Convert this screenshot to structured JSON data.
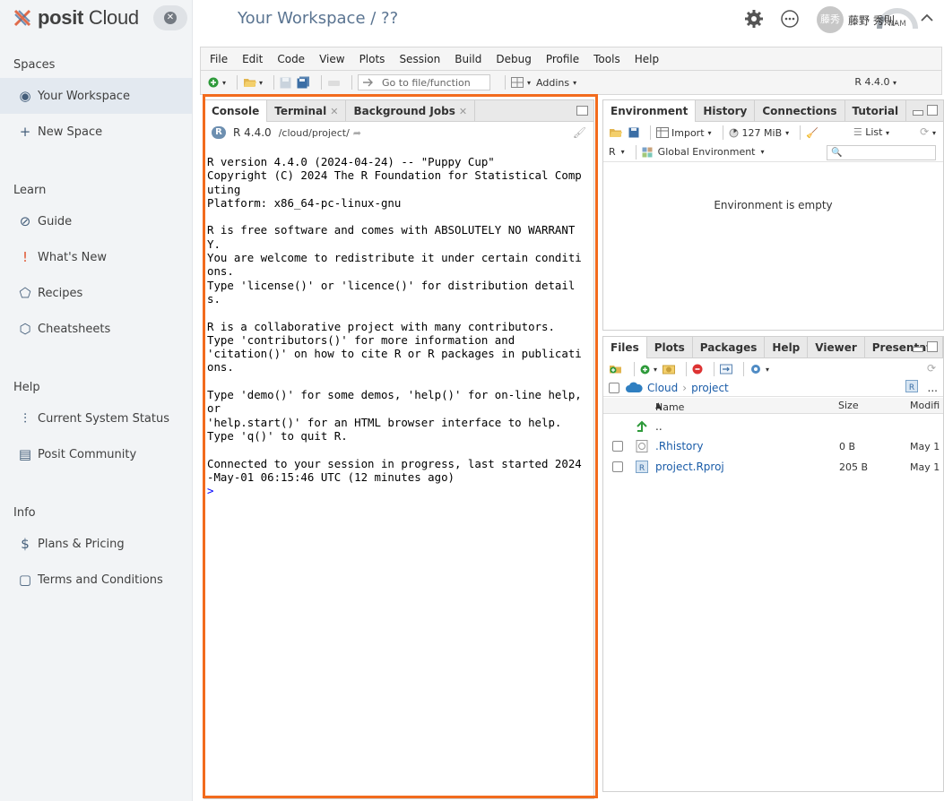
{
  "brand": {
    "name_bold": "posit",
    "name_rest": " Cloud"
  },
  "sidebar": {
    "sections": [
      {
        "title": "Spaces",
        "items": [
          {
            "label": "Your Workspace",
            "icon": "person-icon"
          },
          {
            "label": "New Space",
            "icon": "plus-icon"
          }
        ]
      },
      {
        "title": "Learn",
        "items": [
          {
            "label": "Guide",
            "icon": "compass-icon"
          },
          {
            "label": "What's New",
            "icon": "exclamation-icon"
          },
          {
            "label": "Recipes",
            "icon": "pentagon-icon"
          },
          {
            "label": "Cheatsheets",
            "icon": "hexagon-icon"
          }
        ]
      },
      {
        "title": "Help",
        "items": [
          {
            "label": "Current System Status",
            "icon": "pulse-icon"
          },
          {
            "label": "Posit Community",
            "icon": "chat-icon"
          }
        ]
      },
      {
        "title": "Info",
        "items": [
          {
            "label": "Plans & Pricing",
            "icon": "dollar-icon"
          },
          {
            "label": "Terms and Conditions",
            "icon": "document-icon"
          }
        ]
      }
    ]
  },
  "header": {
    "title": "Your Workspace / ??",
    "ram_label": "RAM",
    "avatar_text": "藤秀",
    "username": "藤野 秀則."
  },
  "menu": [
    "File",
    "Edit",
    "Code",
    "View",
    "Plots",
    "Session",
    "Build",
    "Debug",
    "Profile",
    "Tools",
    "Help"
  ],
  "toolbar": {
    "goto_placeholder": "Go to file/function",
    "addins": "Addins",
    "r_version": "R 4.4.0"
  },
  "console": {
    "tabs": [
      {
        "label": "Console"
      },
      {
        "label": "Terminal"
      },
      {
        "label": "Background Jobs"
      }
    ],
    "r_version": "R 4.4.0",
    "path": "/cloud/project/",
    "lines": "R version 4.4.0 (2024-04-24) -- \"Puppy Cup\"\nCopyright (C) 2024 The R Foundation for Statistical Comp\nuting\nPlatform: x86_64-pc-linux-gnu\n\nR is free software and comes with ABSOLUTELY NO WARRANT\nY.\nYou are welcome to redistribute it under certain conditi\nons.\nType 'license()' or 'licence()' for distribution detail\ns.\n\nR is a collaborative project with many contributors.\nType 'contributors()' for more information and\n'citation()' on how to cite R or R packages in publicati\nons.\n\nType 'demo()' for some demos, 'help()' for on-line help,\nor\n'help.start()' for an HTML browser interface to help.\nType 'q()' to quit R.\n\nConnected to your session in progress, last started 2024\n-May-01 06:15:46 UTC (12 minutes ago)",
    "prompt": ">"
  },
  "env": {
    "tabs": [
      "Environment",
      "History",
      "Connections",
      "Tutorial"
    ],
    "import": "Import",
    "memory": "127 MiB",
    "list": "List",
    "lang": "R",
    "scope": "Global Environment",
    "empty": "Environment is empty"
  },
  "files": {
    "tabs": [
      "Files",
      "Plots",
      "Packages",
      "Help",
      "Viewer",
      "Presentati"
    ],
    "crumbs": [
      "Cloud",
      "project"
    ],
    "ellipsis": "...",
    "columns": {
      "name": "Name",
      "size": "Size",
      "modified": "Modifi"
    },
    "parent": "..",
    "rows": [
      {
        "name": ".Rhistory",
        "size": "0 B",
        "modified": "May 1"
      },
      {
        "name": "project.Rproj",
        "size": "205 B",
        "modified": "May 1"
      }
    ]
  }
}
